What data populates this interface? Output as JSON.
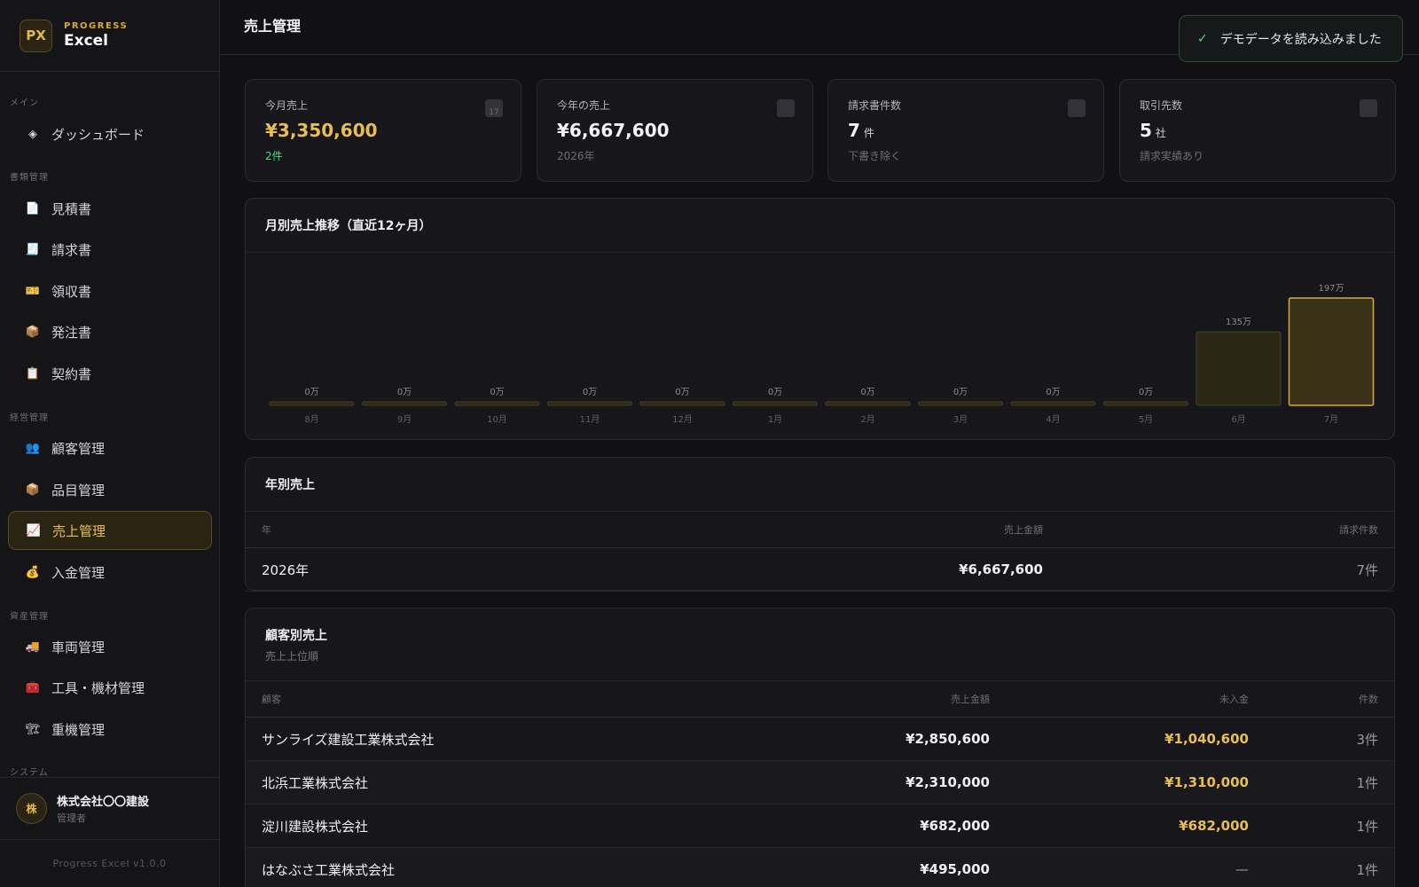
{
  "brand": {
    "logo": "PX",
    "sub": "PROGRESS",
    "name": "Excel"
  },
  "sidebar": {
    "sections": [
      {
        "label": "メイン"
      },
      {
        "label": "書類管理"
      },
      {
        "label": "経営管理"
      },
      {
        "label": "資産管理"
      },
      {
        "label": "システム"
      }
    ],
    "items": [
      {
        "label": "ダッシュボード",
        "icon": "diamond-icon",
        "glyph": "◈"
      },
      {
        "label": "見積書",
        "icon": "document-icon",
        "glyph": "📄"
      },
      {
        "label": "請求書",
        "icon": "receipt-icon",
        "glyph": "🧾"
      },
      {
        "label": "領収書",
        "icon": "ticket-icon",
        "glyph": "🎫"
      },
      {
        "label": "発注書",
        "icon": "package-icon",
        "glyph": "📦"
      },
      {
        "label": "契約書",
        "icon": "clipboard-icon",
        "glyph": "📋"
      },
      {
        "label": "顧客管理",
        "icon": "users-icon",
        "glyph": "👥"
      },
      {
        "label": "品目管理",
        "icon": "package-icon",
        "glyph": "📦"
      },
      {
        "label": "売上管理",
        "icon": "chart-up-icon",
        "glyph": "📈"
      },
      {
        "label": "入金管理",
        "icon": "money-bag-icon",
        "glyph": "💰"
      },
      {
        "label": "車両管理",
        "icon": "truck-icon",
        "glyph": "🚚"
      },
      {
        "label": "工具・機材管理",
        "icon": "toolbox-icon",
        "glyph": "🧰"
      },
      {
        "label": "重機管理",
        "icon": "crane-icon",
        "glyph": "🏗"
      }
    ],
    "active_index": 8
  },
  "user": {
    "avatar": "株",
    "name": "株式会社〇〇建設",
    "role": "管理者"
  },
  "version": "Progress Excel v1.0.0",
  "header": {
    "title": "売上管理"
  },
  "toast": {
    "check": "✓",
    "message": "デモデータを読み込みました"
  },
  "stats": [
    {
      "label": "今月売上",
      "value": "¥3,350,600",
      "unit": "",
      "sub": "2件",
      "icon": "calendar-icon"
    },
    {
      "label": "今年の売上",
      "value": "¥6,667,600",
      "unit": "",
      "sub": "2026年",
      "icon": "notepad-icon"
    },
    {
      "label": "請求書件数",
      "value": "7",
      "unit": "件",
      "sub": "下書き除く",
      "icon": "receipt-icon"
    },
    {
      "label": "取引先数",
      "value": "5",
      "unit": "社",
      "sub": "請求実績あり",
      "icon": "building-icon"
    }
  ],
  "chart_data": {
    "type": "bar",
    "title": "月別売上推移（直近12ヶ月）",
    "categories": [
      "8月",
      "9月",
      "10月",
      "11月",
      "12月",
      "1月",
      "2月",
      "3月",
      "4月",
      "5月",
      "6月",
      "7月"
    ],
    "values": [
      0,
      0,
      0,
      0,
      0,
      0,
      0,
      0,
      0,
      0,
      135,
      197
    ],
    "value_labels": [
      "0万",
      "0万",
      "0万",
      "0万",
      "0万",
      "0万",
      "0万",
      "0万",
      "0万",
      "0万",
      "135万",
      "197万"
    ],
    "unit": "万",
    "ylim": [
      0,
      197
    ],
    "grid": false,
    "highlight_index": 11,
    "colors": {
      "bar_fill": "#2a2716",
      "bar_stroke": "#4a4222",
      "highlight_fill": "#3a3218",
      "highlight_stroke": "#d9a93c"
    }
  },
  "yearly": {
    "title": "年別売上",
    "columns": [
      "年",
      "売上金額",
      "請求件数"
    ],
    "rows": [
      {
        "year": "2026年",
        "amount": "¥6,667,600",
        "count": "7件"
      }
    ]
  },
  "customers": {
    "title": "顧客別売上",
    "subtitle": "売上上位順",
    "columns": [
      "顧客",
      "売上金額",
      "未入金",
      "件数"
    ],
    "rows": [
      {
        "name": "サンライズ建設工業株式会社",
        "amount": "¥2,850,600",
        "unpaid": "¥1,040,600",
        "count": "3件"
      },
      {
        "name": "北浜工業株式会社",
        "amount": "¥2,310,000",
        "unpaid": "¥1,310,000",
        "count": "1件"
      },
      {
        "name": "淀川建設株式会社",
        "amount": "¥682,000",
        "unpaid": "¥682,000",
        "count": "1件"
      },
      {
        "name": "はなぶさ工業株式会社",
        "amount": "¥495,000",
        "unpaid": "—",
        "count": "1件"
      }
    ]
  },
  "colors": {
    "accent": "#e9bd55",
    "positive": "#4ade80",
    "background": "#111114"
  }
}
